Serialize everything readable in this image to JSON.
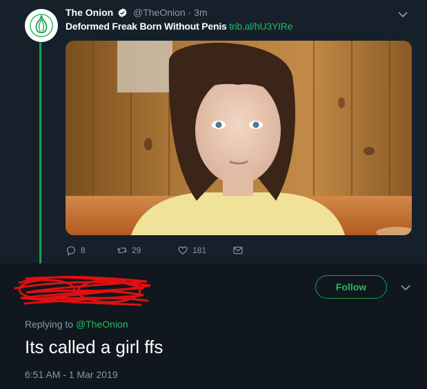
{
  "tweet": {
    "author_name": "The Onion",
    "handle": "@TheOnion",
    "separator": "·",
    "time_ago": "3m",
    "text": "Deformed Freak Born Without Penis",
    "link": "trib.al/hU3YIRe",
    "stats": {
      "replies": "8",
      "retweets": "29",
      "likes": "181"
    },
    "icons": {
      "avatar": "onion-logo-icon",
      "verified": "verified-badge-icon",
      "menu": "chevron-down-icon",
      "reply": "reply-icon",
      "retweet": "retweet-icon",
      "like": "heart-icon",
      "dm": "envelope-icon"
    }
  },
  "reply": {
    "follow_label": "Follow",
    "replying_prefix": "Replying to",
    "replying_handle": "@TheOnion",
    "text": "Its called a girl ffs",
    "timestamp": "6:51 AM - 1 Mar 2019"
  },
  "colors": {
    "background": "#15202b",
    "reply_background": "#10171e",
    "accent": "#17a34a",
    "muted": "#8899a6",
    "redaction": "#e01010"
  }
}
